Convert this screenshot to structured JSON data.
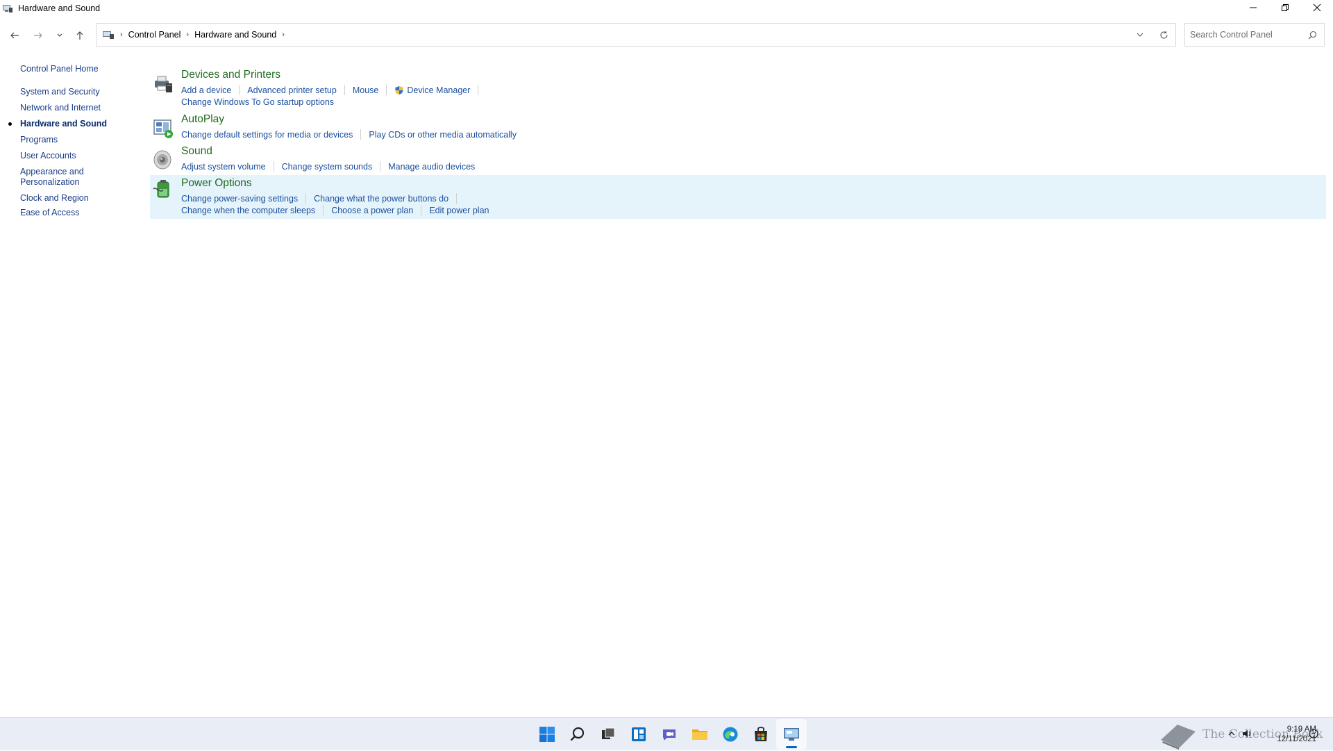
{
  "window": {
    "title": "Hardware and Sound"
  },
  "address": {
    "crumbs": [
      "Control Panel",
      "Hardware and Sound"
    ],
    "search_placeholder": "Search Control Panel"
  },
  "sidebar": {
    "items": [
      {
        "label": "Control Panel Home"
      },
      {
        "label": "System and Security"
      },
      {
        "label": "Network and Internet"
      },
      {
        "label": "Hardware and Sound"
      },
      {
        "label": "Programs"
      },
      {
        "label": "User Accounts"
      },
      {
        "label": "Appearance and Personalization"
      },
      {
        "label": "Clock and Region"
      },
      {
        "label": "Ease of Access"
      }
    ],
    "active_item": "Hardware and Sound"
  },
  "categories": [
    {
      "title": "Devices and Printers",
      "icon": "printer-icon",
      "links": [
        [
          "Add a device",
          "Advanced printer setup",
          "Mouse",
          "Device Manager"
        ],
        [
          "Change Windows To Go startup options"
        ]
      ]
    },
    {
      "title": "AutoPlay",
      "icon": "autoplay-icon",
      "links": [
        [
          "Change default settings for media or devices",
          "Play CDs or other media automatically"
        ]
      ]
    },
    {
      "title": "Sound",
      "icon": "speaker-icon",
      "links": [
        [
          "Adjust system volume",
          "Change system sounds",
          "Manage audio devices"
        ]
      ]
    },
    {
      "title": "Power Options",
      "icon": "battery-icon",
      "links": [
        [
          "Change power-saving settings",
          "Change what the power buttons do"
        ],
        [
          "Change when the computer sleeps",
          "Choose a power plan",
          "Edit power plan"
        ]
      ]
    }
  ],
  "taskbar": {
    "icons": [
      "windows-start-icon",
      "search-icon",
      "task-view-icon",
      "widgets-icon",
      "chat-icon",
      "file-explorer-icon",
      "edge-icon",
      "store-icon",
      "control-panel-icon"
    ],
    "active_icon": "control-panel-icon",
    "time": "9:19 AM",
    "date": "12/11/2021",
    "watermark": "The Collection Book"
  },
  "colors": {
    "link": "#1a4f9f",
    "category_title": "#1e6b1e",
    "highlight": "#e5f3fb",
    "taskbar": "#e9eef6"
  }
}
